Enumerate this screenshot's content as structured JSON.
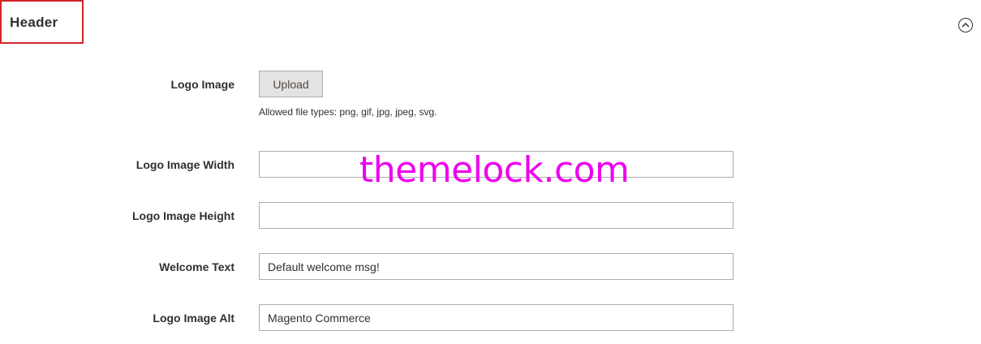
{
  "section": {
    "title": "Header"
  },
  "fields": {
    "logo_image": {
      "label": "Logo Image",
      "upload_label": "Upload",
      "hint": "Allowed file types: png, gif, jpg, jpeg, svg."
    },
    "logo_width": {
      "label": "Logo Image Width",
      "value": ""
    },
    "logo_height": {
      "label": "Logo Image Height",
      "value": ""
    },
    "welcome_text": {
      "label": "Welcome Text",
      "value": "Default welcome msg!"
    },
    "logo_alt": {
      "label": "Logo Image Alt",
      "value": "Magento Commerce"
    }
  },
  "watermark": {
    "text": "themelock.com",
    "color": "#ee00ee"
  },
  "icons": {
    "collapse": "chevron-up-circle-icon"
  },
  "colors": {
    "section_border": "#d0262b",
    "button_bg": "#e3e3e3",
    "input_border": "#adadad"
  }
}
